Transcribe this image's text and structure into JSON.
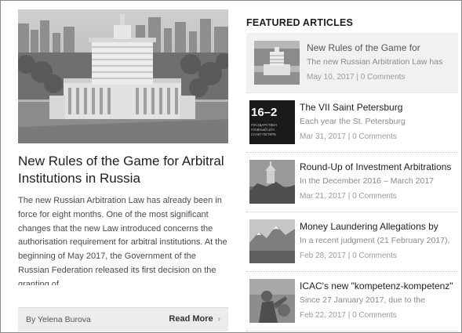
{
  "main_article": {
    "title": "New Rules of the Game for Arbitral Institutions in Russia",
    "excerpt": "The new Russian Arbitration Law has already been in force for eight months. One of the most significant changes that the new Law introduced concerns the authorisation requirement for arbitral institutions. At the beginning of May 2017, the Government of the Russian Federation released its first decision on the granting of",
    "author": "By Yelena Burova",
    "read_more": "Read More",
    "read_more_icon": "chevron-right-icon"
  },
  "featured": {
    "heading": "FEATURED ARTICLES",
    "items": [
      {
        "title": "New Rules of the Game for",
        "excerpt": "The new Russian Arbitration Law has",
        "meta": "May 10, 2017 | 0 Comments",
        "thumb": "building-photo"
      },
      {
        "title": "The VII Saint Petersburg",
        "excerpt": "Each year the St. Petersburg",
        "meta": "Mar 31, 2017 | 0 Comments",
        "thumb": "event-banner",
        "thumb_text": "16–2",
        "thumb_subtext": [
          "ГОСУДАРСТВЕН",
          "ГЛАВНЫЙ ШТА",
          "САНКТ-ПЕТЕРБ"
        ]
      },
      {
        "title": "Round-Up of Investment Arbitrations",
        "excerpt": "In the December 2016 – March 2017",
        "meta": "Mar 21, 2017 | 0 Comments",
        "thumb": "coastal-castle-photo"
      },
      {
        "title": "Money Laundering Allegations by",
        "excerpt": "In a recent judgment (21 February 2017),",
        "meta": "Feb 28, 2017 | 0 Comments",
        "thumb": "mountain-photo"
      },
      {
        "title": "ICAC's new \"kompetenz-kompetenz\"",
        "excerpt": "Since 27 January 2017, due to the",
        "meta": "Feb 22, 2017 | 0 Comments",
        "thumb": "statue-photo"
      }
    ]
  }
}
